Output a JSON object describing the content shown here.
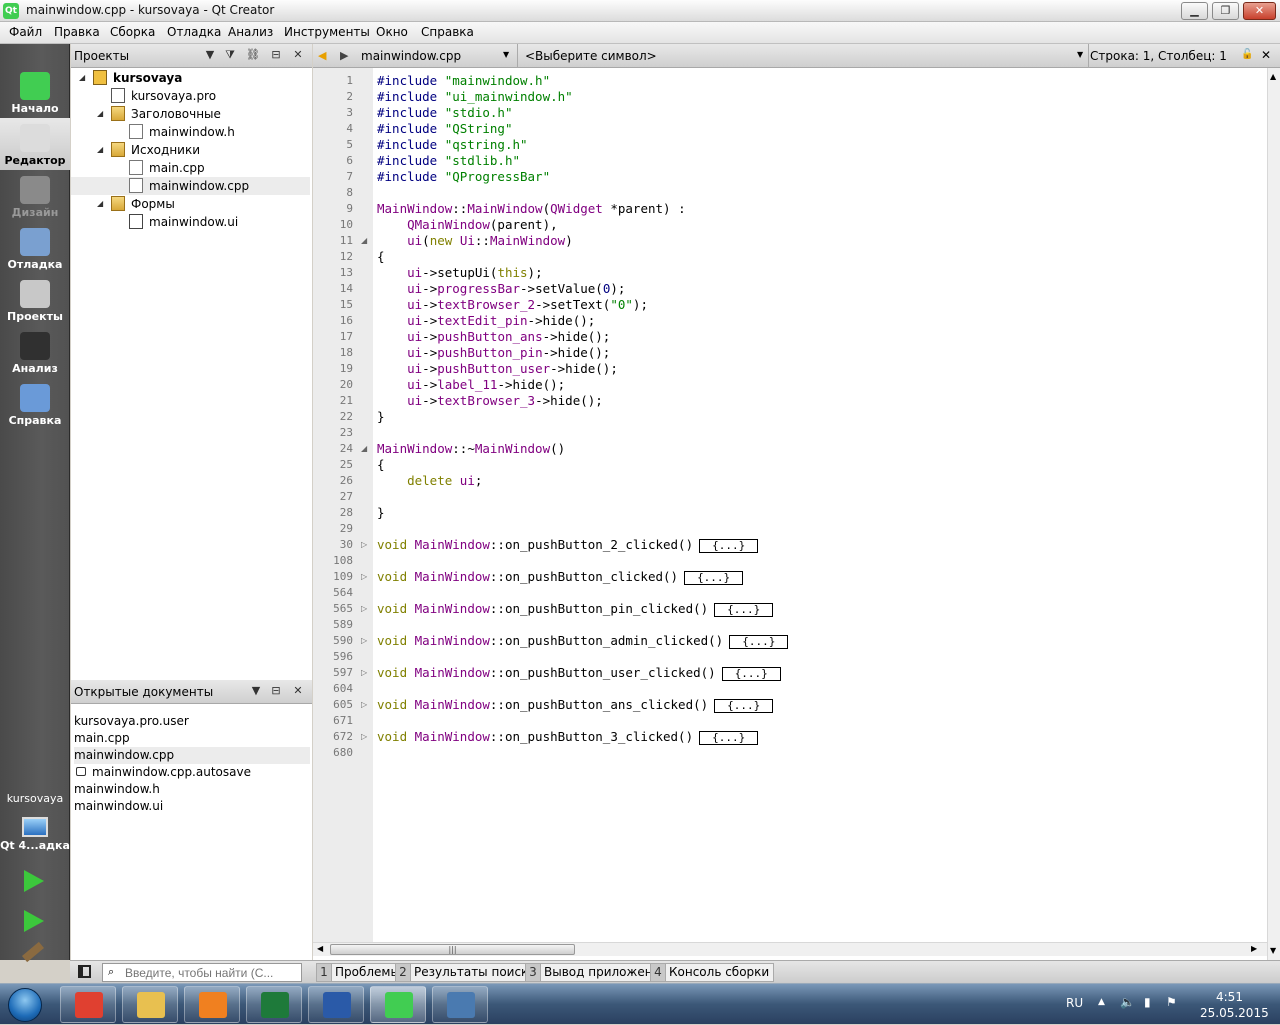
{
  "window": {
    "title": "mainwindow.cpp - kursovaya - Qt Creator"
  },
  "menu": [
    "Файл",
    "Правка",
    "Сборка",
    "Отладка",
    "Анализ",
    "Инструменты",
    "Окно",
    "Справка"
  ],
  "modes": [
    {
      "label": "Начало",
      "state": "normal",
      "color": "#41cd52"
    },
    {
      "label": "Редактор",
      "state": "active",
      "color": "#dcdcdc"
    },
    {
      "label": "Дизайн",
      "state": "disabled",
      "color": "#8a8a8a"
    },
    {
      "label": "Отладка",
      "state": "normal",
      "color": "#7aa0d0"
    },
    {
      "label": "Проекты",
      "state": "normal",
      "color": "#c8c8c8"
    },
    {
      "label": "Анализ",
      "state": "normal",
      "color": "#303030"
    },
    {
      "label": "Справка",
      "state": "normal",
      "color": "#6a9ad8"
    }
  ],
  "target": {
    "project": "kursovaya",
    "kit": "Qt 4...адка"
  },
  "projects_panel": {
    "title": "Проекты"
  },
  "tree": [
    {
      "label": "kursovaya",
      "type": "proj",
      "level": 0,
      "arrow": "open",
      "bold": true
    },
    {
      "label": "kursovaya.pro",
      "type": "pro",
      "level": 1,
      "arrow": ""
    },
    {
      "label": "Заголовочные",
      "type": "folder",
      "level": 1,
      "arrow": "open"
    },
    {
      "label": "mainwindow.h",
      "type": "file",
      "level": 2,
      "arrow": ""
    },
    {
      "label": "Исходники",
      "type": "folder",
      "level": 1,
      "arrow": "open"
    },
    {
      "label": "main.cpp",
      "type": "file",
      "level": 2,
      "arrow": ""
    },
    {
      "label": "mainwindow.cpp",
      "type": "file",
      "level": 2,
      "arrow": "",
      "selected": true
    },
    {
      "label": "Формы",
      "type": "folder",
      "level": 1,
      "arrow": "open"
    },
    {
      "label": "mainwindow.ui",
      "type": "ui",
      "level": 2,
      "arrow": ""
    }
  ],
  "open_docs": {
    "title": "Открытые документы",
    "items": [
      {
        "label": "kursovaya.pro.user"
      },
      {
        "label": "main.cpp"
      },
      {
        "label": "mainwindow.cpp",
        "selected": true
      },
      {
        "label": "mainwindow.cpp.autosave",
        "locked": true
      },
      {
        "label": "mainwindow.h"
      },
      {
        "label": "mainwindow.ui"
      }
    ]
  },
  "editor": {
    "file": "mainwindow.cpp",
    "symbol": "<Выберите символ>",
    "position": "Строка: 1, Столбец: 1"
  },
  "code": [
    {
      "n": "1",
      "t": [
        [
          "pp",
          "#include "
        ],
        [
          "str",
          "\"mainwindow.h\""
        ]
      ]
    },
    {
      "n": "2",
      "t": [
        [
          "pp",
          "#include "
        ],
        [
          "str",
          "\"ui_mainwindow.h\""
        ]
      ]
    },
    {
      "n": "3",
      "t": [
        [
          "pp",
          "#include "
        ],
        [
          "str",
          "\"stdio.h\""
        ]
      ]
    },
    {
      "n": "4",
      "t": [
        [
          "pp",
          "#include "
        ],
        [
          "str",
          "\"QString\""
        ]
      ]
    },
    {
      "n": "5",
      "t": [
        [
          "pp",
          "#include "
        ],
        [
          "str",
          "\"qstring.h\""
        ]
      ]
    },
    {
      "n": "6",
      "t": [
        [
          "pp",
          "#include "
        ],
        [
          "str",
          "\"stdlib.h\""
        ]
      ]
    },
    {
      "n": "7",
      "t": [
        [
          "pp",
          "#include "
        ],
        [
          "str",
          "\"QProgressBar\""
        ]
      ]
    },
    {
      "n": "8",
      "t": []
    },
    {
      "n": "9",
      "t": [
        [
          "cls",
          "MainWindow"
        ],
        [
          "",
          "::"
        ],
        [
          "cls",
          "MainWindow"
        ],
        [
          "",
          "("
        ],
        [
          "cls",
          "QWidget"
        ],
        [
          "",
          " *parent) :"
        ]
      ]
    },
    {
      "n": "10",
      "t": [
        [
          "",
          "    "
        ],
        [
          "cls",
          "QMainWindow"
        ],
        [
          "",
          "(parent),"
        ]
      ]
    },
    {
      "n": "11",
      "fold": "◢",
      "t": [
        [
          "",
          "    "
        ],
        [
          "cls",
          "ui"
        ],
        [
          "",
          "("
        ],
        [
          "kw",
          "new "
        ],
        [
          "cls",
          "Ui"
        ],
        [
          "",
          "::"
        ],
        [
          "cls",
          "MainWindow"
        ],
        [
          "",
          ")"
        ]
      ]
    },
    {
      "n": "12",
      "t": [
        [
          "",
          "{"
        ]
      ]
    },
    {
      "n": "13",
      "t": [
        [
          "",
          "    "
        ],
        [
          "cls",
          "ui"
        ],
        [
          "",
          "->setupUi("
        ],
        [
          "kw",
          "this"
        ],
        [
          "",
          ");"
        ]
      ]
    },
    {
      "n": "14",
      "t": [
        [
          "",
          "    "
        ],
        [
          "cls",
          "ui"
        ],
        [
          "",
          "->"
        ],
        [
          "cls",
          "progressBar"
        ],
        [
          "",
          "->setValue("
        ],
        [
          "num",
          "0"
        ],
        [
          "",
          ");"
        ]
      ]
    },
    {
      "n": "15",
      "t": [
        [
          "",
          "    "
        ],
        [
          "cls",
          "ui"
        ],
        [
          "",
          "->"
        ],
        [
          "cls",
          "textBrowser_2"
        ],
        [
          "",
          "->setText("
        ],
        [
          "str",
          "\"0\""
        ],
        [
          "",
          ");"
        ]
      ]
    },
    {
      "n": "16",
      "t": [
        [
          "",
          "    "
        ],
        [
          "cls",
          "ui"
        ],
        [
          "",
          "->"
        ],
        [
          "cls",
          "textEdit_pin"
        ],
        [
          "",
          "->hide();"
        ]
      ]
    },
    {
      "n": "17",
      "t": [
        [
          "",
          "    "
        ],
        [
          "cls",
          "ui"
        ],
        [
          "",
          "->"
        ],
        [
          "cls",
          "pushButton_ans"
        ],
        [
          "",
          "->hide();"
        ]
      ]
    },
    {
      "n": "18",
      "t": [
        [
          "",
          "    "
        ],
        [
          "cls",
          "ui"
        ],
        [
          "",
          "->"
        ],
        [
          "cls",
          "pushButton_pin"
        ],
        [
          "",
          "->hide();"
        ]
      ]
    },
    {
      "n": "19",
      "t": [
        [
          "",
          "    "
        ],
        [
          "cls",
          "ui"
        ],
        [
          "",
          "->"
        ],
        [
          "cls",
          "pushButton_user"
        ],
        [
          "",
          "->hide();"
        ]
      ]
    },
    {
      "n": "20",
      "t": [
        [
          "",
          "    "
        ],
        [
          "cls",
          "ui"
        ],
        [
          "",
          "->"
        ],
        [
          "cls",
          "label_11"
        ],
        [
          "",
          "->hide();"
        ]
      ]
    },
    {
      "n": "21",
      "t": [
        [
          "",
          "    "
        ],
        [
          "cls",
          "ui"
        ],
        [
          "",
          "->"
        ],
        [
          "cls",
          "textBrowser_3"
        ],
        [
          "",
          "->hide();"
        ]
      ]
    },
    {
      "n": "22",
      "t": [
        [
          "",
          "}"
        ]
      ]
    },
    {
      "n": "23",
      "t": []
    },
    {
      "n": "24",
      "fold": "◢",
      "t": [
        [
          "cls",
          "MainWindow"
        ],
        [
          "",
          "::~"
        ],
        [
          "cls",
          "MainWindow"
        ],
        [
          "",
          "()"
        ]
      ]
    },
    {
      "n": "25",
      "t": [
        [
          "",
          "{"
        ]
      ]
    },
    {
      "n": "26",
      "t": [
        [
          "",
          "    "
        ],
        [
          "kw",
          "delete "
        ],
        [
          "cls",
          "ui"
        ],
        [
          "",
          ";"
        ]
      ]
    },
    {
      "n": "27",
      "t": []
    },
    {
      "n": "28",
      "t": [
        [
          "",
          "}"
        ]
      ]
    },
    {
      "n": "29",
      "t": []
    },
    {
      "n": "30",
      "fold": "▷",
      "t": [
        [
          "kw",
          "void "
        ],
        [
          "cls",
          "MainWindow"
        ],
        [
          "",
          "::on_pushButton_2_clicked()"
        ]
      ],
      "box": "{...}"
    },
    {
      "n": "108",
      "t": []
    },
    {
      "n": "109",
      "fold": "▷",
      "t": [
        [
          "kw",
          "void "
        ],
        [
          "cls",
          "MainWindow"
        ],
        [
          "",
          "::on_pushButton_clicked()"
        ]
      ],
      "box": "{...}"
    },
    {
      "n": "564",
      "t": []
    },
    {
      "n": "565",
      "fold": "▷",
      "t": [
        [
          "kw",
          "void "
        ],
        [
          "cls",
          "MainWindow"
        ],
        [
          "",
          "::on_pushButton_pin_clicked()"
        ]
      ],
      "box": "{...}"
    },
    {
      "n": "589",
      "t": []
    },
    {
      "n": "590",
      "fold": "▷",
      "t": [
        [
          "kw",
          "void "
        ],
        [
          "cls",
          "MainWindow"
        ],
        [
          "",
          "::on_pushButton_admin_clicked()"
        ]
      ],
      "box": "{...}"
    },
    {
      "n": "596",
      "t": []
    },
    {
      "n": "597",
      "fold": "▷",
      "t": [
        [
          "kw",
          "void "
        ],
        [
          "cls",
          "MainWindow"
        ],
        [
          "",
          "::on_pushButton_user_clicked()"
        ]
      ],
      "box": "{...}"
    },
    {
      "n": "604",
      "t": []
    },
    {
      "n": "605",
      "fold": "▷",
      "t": [
        [
          "kw",
          "void "
        ],
        [
          "cls",
          "MainWindow"
        ],
        [
          "",
          "::on_pushButton_ans_clicked()"
        ]
      ],
      "box": "{...}"
    },
    {
      "n": "671",
      "t": []
    },
    {
      "n": "672",
      "fold": "▷",
      "t": [
        [
          "kw",
          "void "
        ],
        [
          "cls",
          "MainWindow"
        ],
        [
          "",
          "::on_pushButton_3_clicked()"
        ]
      ],
      "box": "{...}"
    },
    {
      "n": "680",
      "t": []
    }
  ],
  "search": {
    "placeholder": "Введите, чтобы найти (C..."
  },
  "output_panes": [
    {
      "num": "1",
      "label": "Проблемы"
    },
    {
      "num": "2",
      "label": "Результаты поиска"
    },
    {
      "num": "3",
      "label": "Вывод приложения"
    },
    {
      "num": "4",
      "label": "Консоль сборки"
    }
  ],
  "taskbar": {
    "apps": [
      {
        "name": "chrome-icon",
        "color": "#e04030"
      },
      {
        "name": "explorer-icon",
        "color": "#e8c050"
      },
      {
        "name": "media-player-icon",
        "color": "#f08020"
      },
      {
        "name": "excel-icon",
        "color": "#1e7a3a"
      },
      {
        "name": "word-icon",
        "color": "#2a5aa8"
      },
      {
        "name": "qt-creator-icon",
        "color": "#41cd52",
        "active": true
      },
      {
        "name": "window-app-icon",
        "color": "#4a7ab0"
      }
    ],
    "lang": "RU",
    "time": "4:51",
    "date": "25.05.2015"
  }
}
